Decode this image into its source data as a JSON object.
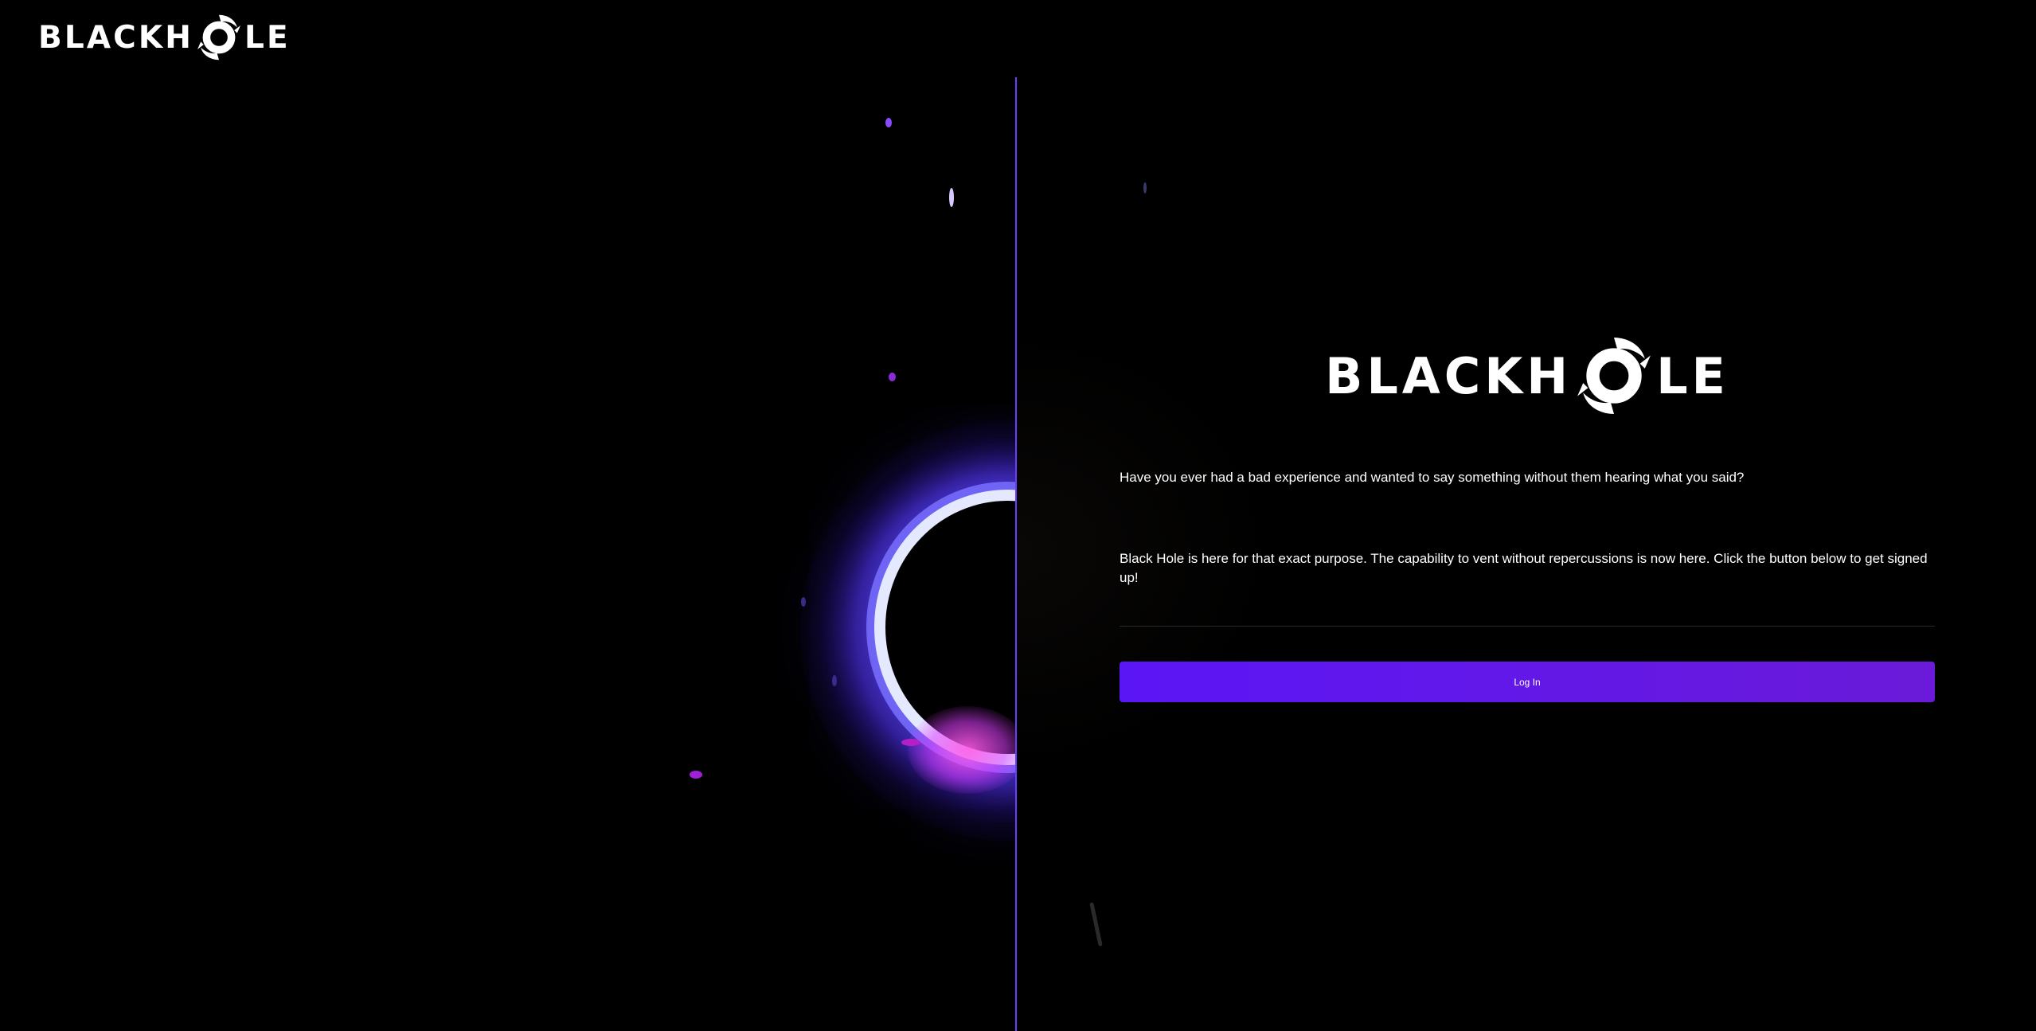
{
  "header": {
    "logo_text": "BLACKHOLE",
    "logo_left": "BLACKH",
    "logo_right": "LE",
    "logo_icon": "swirl-o-icon"
  },
  "hero": {
    "image_icon": "black-hole-ring-image"
  },
  "panel": {
    "logo_left": "BLACKH",
    "logo_right": "LE",
    "intro_text": "Have you ever had a bad experience and wanted to say something without them hearing what you said?",
    "description_text": "Black Hole is here for that exact purpose. The capability to vent without repercussions is now here. Click the button below to get signed up!",
    "login_label": "Log In"
  },
  "colors": {
    "background": "#000000",
    "accent": "#5b16f6",
    "divider": "#6a3dff",
    "text": "#ffffff"
  }
}
